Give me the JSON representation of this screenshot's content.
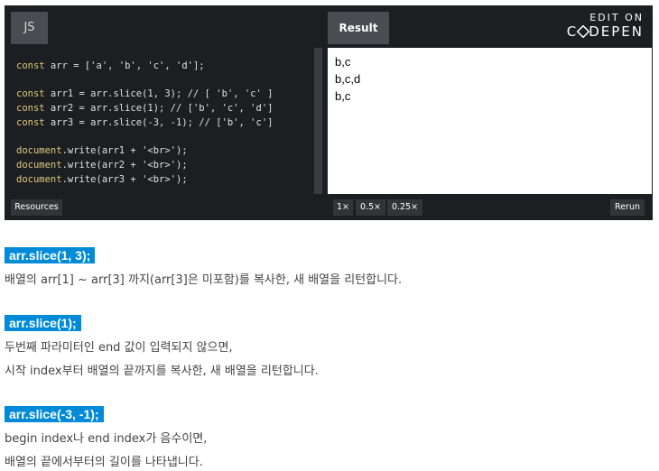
{
  "codepen": {
    "tab_js": "JS",
    "tab_result": "Result",
    "edit_on": "EDIT ON",
    "brand_left": "C",
    "brand_right": "DEPEN",
    "code_lines": [
      {
        "kw": "const",
        "rest": " arr = ['a', 'b', 'c', 'd'];"
      },
      {
        "kw": "const",
        "rest": " arr1 = arr.slice(1, 3); // [ 'b', 'c' ]"
      },
      {
        "kw": "const",
        "rest": " arr2 = arr.slice(1); // ['b', 'c', 'd']"
      },
      {
        "kw": "const",
        "rest": " arr3 = arr.slice(-3, -1); // ['b', 'c']"
      },
      {
        "kw": "document",
        "rest": ".write(arr1 + '<br>');"
      },
      {
        "kw": "document",
        "rest": ".write(arr2 + '<br>');"
      },
      {
        "kw": "document",
        "rest": ".write(arr3 + '<br>');"
      }
    ],
    "result_lines": [
      "b,c",
      "b,c,d",
      "b,c"
    ],
    "resources_label": "Resources",
    "zoom_options": [
      "1×",
      "0.5×",
      "0.25×"
    ],
    "rerun_label": "Rerun"
  },
  "sections": [
    {
      "heading": "arr.slice(1, 3);",
      "lines": [
        "배열의 arr[1] ~ arr[3] 까지(arr[3]은 미포함)를 복사한, 새 배열을 리턴합니다."
      ]
    },
    {
      "heading": "arr.slice(1);",
      "lines": [
        "두번째 파라미터인 end 값이 입력되지 않으면,",
        "시작 index부터 배열의 끝까지를 복사한, 새 배열을 리턴합니다."
      ]
    },
    {
      "heading": "arr.slice(-3, -1);",
      "lines": [
        "begin index나 end index가 음수이면,",
        "배열의 끝에서부터의 길이를 나타냅니다."
      ]
    }
  ]
}
